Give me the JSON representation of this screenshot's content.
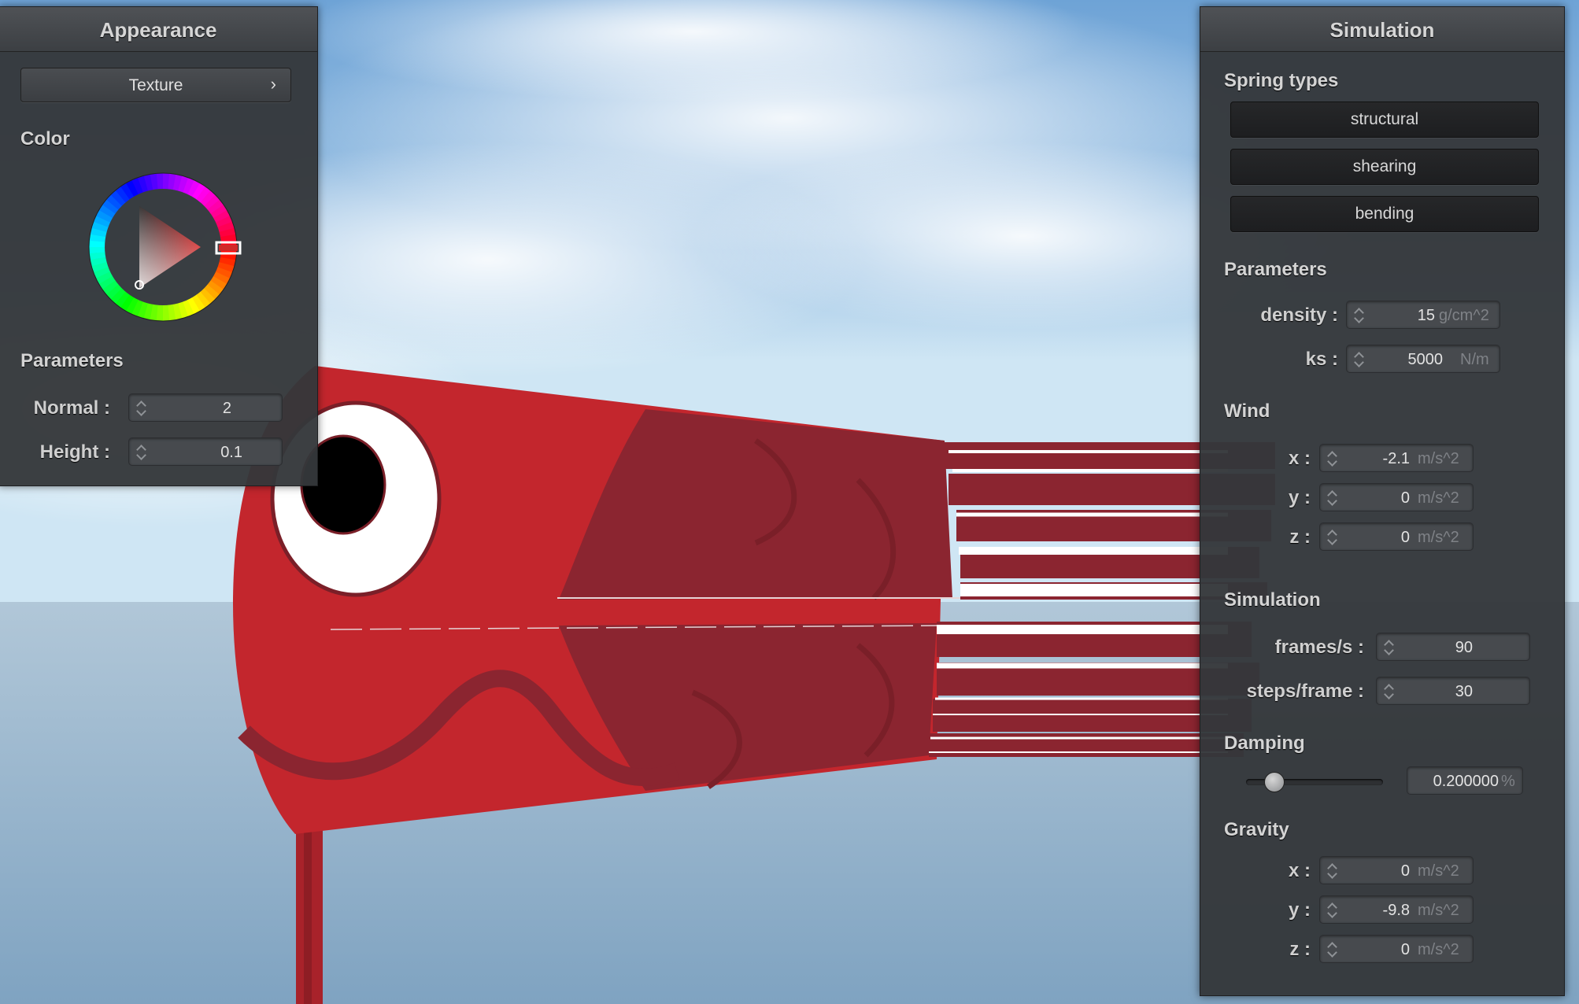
{
  "appearance": {
    "title": "Appearance",
    "texture_label": "Texture",
    "texture_chevron": "›",
    "color_heading": "Color",
    "color_value": "#d02a2a",
    "parameters_heading": "Parameters",
    "normal": {
      "label": "Normal :",
      "value": "2"
    },
    "height": {
      "label": "Height :",
      "value": "0.1"
    }
  },
  "simulation_panel": {
    "title": "Simulation",
    "spring_types_heading": "Spring types",
    "spring_types": [
      "structural",
      "shearing",
      "bending"
    ],
    "parameters_heading": "Parameters",
    "density": {
      "label": "density :",
      "value": "15",
      "unit": "g/cm^2"
    },
    "ks": {
      "label": "ks :",
      "value": "5000",
      "unit": "N/m"
    },
    "wind_heading": "Wind",
    "wind": [
      {
        "label": "x :",
        "value": "-2.1",
        "unit": "m/s^2"
      },
      {
        "label": "y :",
        "value": "0",
        "unit": "m/s^2"
      },
      {
        "label": "z :",
        "value": "0",
        "unit": "m/s^2"
      }
    ],
    "simulation_heading": "Simulation",
    "frames": {
      "label": "frames/s :",
      "value": "90"
    },
    "steps": {
      "label": "steps/frame :",
      "value": "30"
    },
    "damping_heading": "Damping",
    "damping": {
      "value": "0.200000",
      "unit": "%",
      "slider_fraction": 0.2
    },
    "gravity_heading": "Gravity",
    "gravity": [
      {
        "label": "x :",
        "value": "0",
        "unit": "m/s^2"
      },
      {
        "label": "y :",
        "value": "-9.8",
        "unit": "m/s^2"
      },
      {
        "label": "z :",
        "value": "0",
        "unit": "m/s^2"
      }
    ]
  },
  "scene": {
    "windsock_color": "#c3262d",
    "windsock_dark": "#8b2530"
  }
}
